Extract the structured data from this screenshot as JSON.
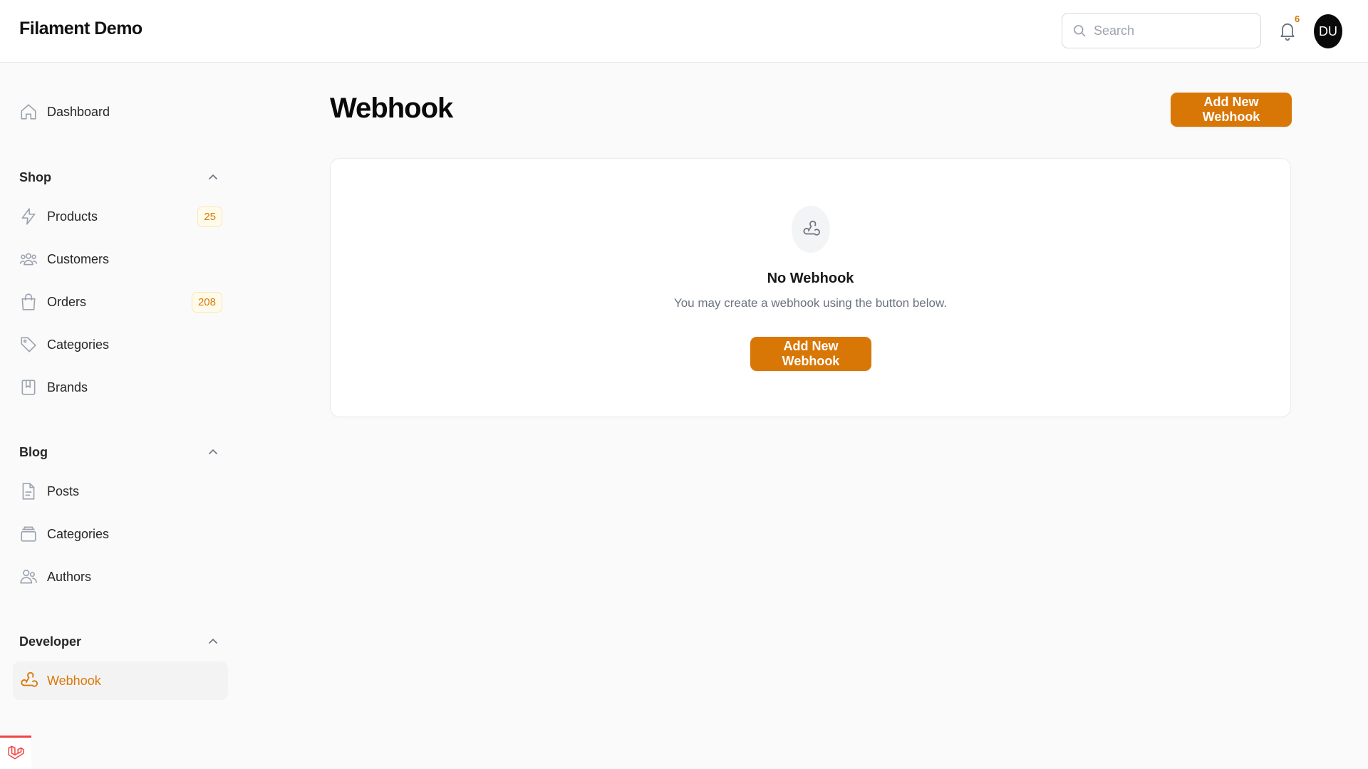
{
  "app": {
    "brand": "Filament Demo",
    "search_placeholder": "Search",
    "notifications_count": "6",
    "avatar_initials": "DU"
  },
  "sidebar": {
    "dashboard": "Dashboard",
    "groups": [
      {
        "label": "Shop",
        "items": [
          {
            "label": "Products",
            "badge": "25",
            "icon": "bolt-icon"
          },
          {
            "label": "Customers",
            "icon": "users-icon"
          },
          {
            "label": "Orders",
            "badge": "208",
            "icon": "shopping-bag-icon"
          },
          {
            "label": "Categories",
            "icon": "tag-icon"
          },
          {
            "label": "Brands",
            "icon": "bookmark-icon"
          }
        ]
      },
      {
        "label": "Blog",
        "items": [
          {
            "label": "Posts",
            "icon": "document-icon"
          },
          {
            "label": "Categories",
            "icon": "folder-icon"
          },
          {
            "label": "Authors",
            "icon": "user-group-icon"
          }
        ]
      },
      {
        "label": "Developer",
        "items": [
          {
            "label": "Webhook",
            "icon": "webhook-icon",
            "active": true
          }
        ]
      }
    ]
  },
  "main": {
    "title": "Webhook",
    "header_button": "Add New Webhook",
    "empty_state": {
      "title": "No Webhook",
      "description": "You may create a webhook using the button below.",
      "button": "Add New Webhook"
    }
  },
  "colors": {
    "accent": "#d97706",
    "active_bg": "#f3f3f3",
    "page_bg": "#fafafa"
  }
}
